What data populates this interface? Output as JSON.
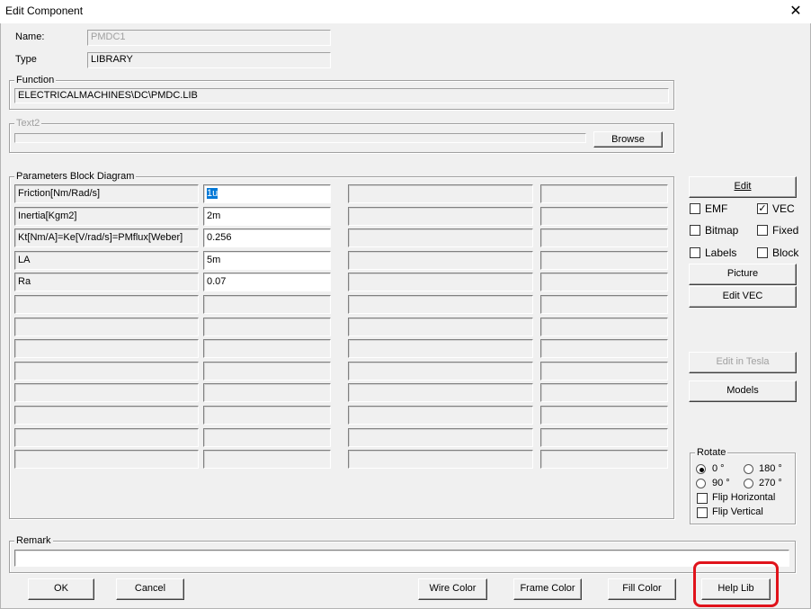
{
  "window": {
    "title": "Edit Component",
    "close_glyph": "✕"
  },
  "name": {
    "label": "Name:",
    "value": "PMDC1"
  },
  "type": {
    "label": "Type",
    "value": "LIBRARY"
  },
  "function": {
    "label": "Function",
    "value": "ELECTRICALMACHINES\\DC\\PMDC.LIB"
  },
  "text2": {
    "label": "Text2",
    "value": "",
    "browse_label": "Browse"
  },
  "params": {
    "label": "Parameters Block Diagram",
    "rows": [
      {
        "name": "Friction[Nm/Rad/s]",
        "value": "1u"
      },
      {
        "name": "Inertia[Kgm2]",
        "value": "2m"
      },
      {
        "name": "Kt[Nm/A]=Ke[V/rad/s]=PMflux[Weber]",
        "value": "0.256"
      },
      {
        "name": "LA",
        "value": "5m"
      },
      {
        "name": "Ra",
        "value": "0.07"
      }
    ]
  },
  "side": {
    "edit_label": "Edit",
    "emf_label": "EMF",
    "emf_checked": false,
    "vec_label": "VEC",
    "vec_checked": true,
    "bitmap_label": "Bitmap",
    "bitmap_checked": false,
    "fixed_label": "Fixed",
    "fixed_checked": false,
    "labels_label": "Labels",
    "labels_checked": false,
    "block_label": "Block",
    "block_checked": false,
    "picture_label": "Picture",
    "edit_vec_label": "Edit VEC",
    "edit_in_tesla_label": "Edit in Tesla",
    "models_label": "Models"
  },
  "rotate": {
    "label": "Rotate",
    "opt_0": "0 °",
    "opt_180": "180 °",
    "opt_90": "90 °",
    "opt_270": "270 °",
    "selected": "0 °",
    "flip_h_label": "Flip Horizontal",
    "flip_h_checked": false,
    "flip_v_label": "Flip Vertical",
    "flip_v_checked": false
  },
  "remark": {
    "label": "Remark",
    "value": ""
  },
  "footer": {
    "ok_label": "OK",
    "cancel_label": "Cancel",
    "wire_color_label": "Wire Color",
    "frame_color_label": "Frame Color",
    "fill_color_label": "Fill Color",
    "help_lib_label": "Help Lib",
    "highlight_color": "#e0131b"
  }
}
